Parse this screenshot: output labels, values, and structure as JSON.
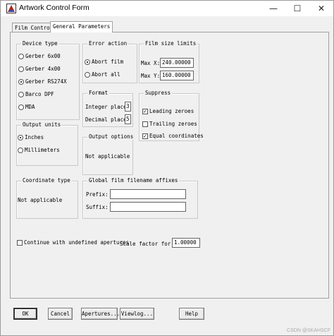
{
  "window": {
    "title": "Artwork Control Form",
    "minimize_glyph": "—",
    "maximize_glyph": "☐",
    "close_glyph": "✕",
    "icon": "artwork-app-icon"
  },
  "tabs": [
    {
      "label": "Film Control",
      "selected": false
    },
    {
      "label": "General Parameters",
      "selected": true
    }
  ],
  "device_type": {
    "title": "Device type",
    "options": [
      "Gerber 6x00",
      "Gerber 4x00",
      "Gerber RS274X",
      "Barco DPF",
      "MDA"
    ],
    "selected": "Gerber RS274X"
  },
  "error_action": {
    "title": "Error action",
    "options": [
      "Abort film",
      "Abort all"
    ],
    "selected": "Abort film"
  },
  "film_size": {
    "title": "Film size limits",
    "max_x_label": "Max X:",
    "max_x_value": "240.00000",
    "max_y_label": "Max Y:",
    "max_y_value": "160.00000"
  },
  "format": {
    "title": "Format",
    "integer_label": "Integer places",
    "integer_value": "3",
    "decimal_label": "Decimal places",
    "decimal_value": "5"
  },
  "suppress": {
    "title": "Suppress",
    "leading_label": "Leading zeroes",
    "leading_checked": true,
    "trailing_label": "Trailing zeroes",
    "trailing_checked": false,
    "equal_label": "Equal coordinates",
    "equal_checked": true
  },
  "output_units": {
    "title": "Output units",
    "options": [
      "Inches",
      "Millimeters"
    ],
    "selected": "Inches"
  },
  "output_options": {
    "title": "Output options",
    "text": "Not applicable"
  },
  "coordinate_type": {
    "title": "Coordinate type",
    "text": "Not applicable"
  },
  "affixes": {
    "title": "Global film filename affixes",
    "prefix_label": "Prefix:",
    "prefix_value": "",
    "suffix_label": "Suffix:",
    "suffix_value": ""
  },
  "continue_undefined": {
    "label": "Continue with undefined apertures",
    "checked": false
  },
  "scale_factor": {
    "label": "Scale factor for o",
    "value": "1.00000"
  },
  "buttons": {
    "ok": "OK",
    "cancel": "Cancel",
    "apertures": "Apertures...",
    "viewlog": "Viewlog...",
    "help": "Help"
  },
  "watermark": "CSDN @SKAHSCF",
  "colors": {
    "accent_icon": "#b22222"
  }
}
